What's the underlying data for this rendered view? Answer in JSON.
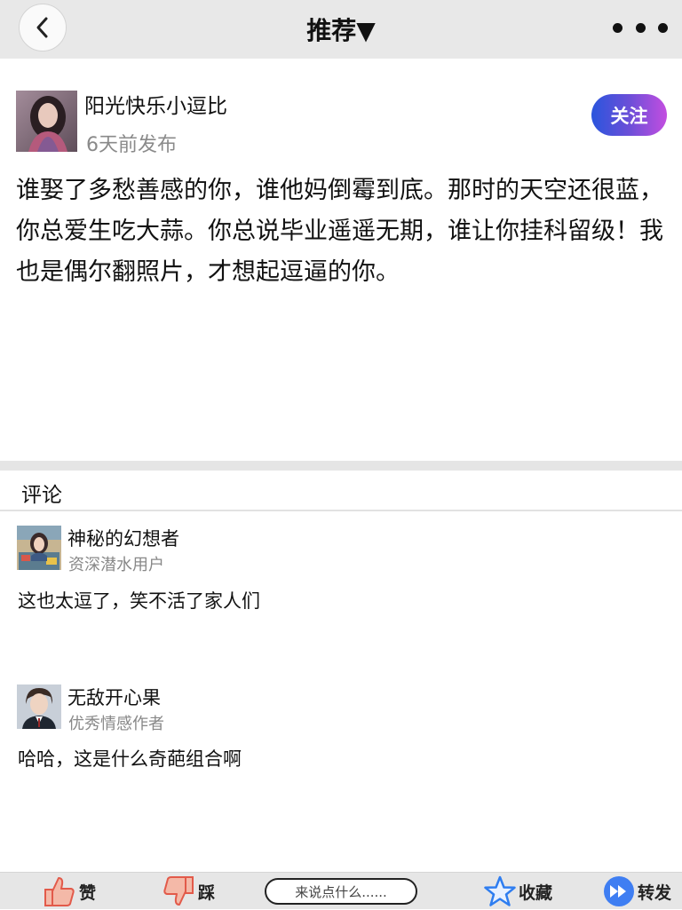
{
  "header": {
    "title": "推荐▼"
  },
  "post": {
    "author": "阳光快乐小逗比",
    "time": "6天前发布",
    "follow_label": "关注",
    "text": "谁娶了多愁善感的你，谁他妈倒霉到底。那时的天空还很蓝，你总爱生吃大蒜。你总说毕业遥遥无期，谁让你挂科留级！我也是偶尔翻照片，才想起逗逼的你。"
  },
  "comments_section": {
    "title": "评论",
    "items": [
      {
        "name": "神秘的幻想者",
        "role": "资深潜水用户",
        "text": "这也太逗了，笑不活了家人们"
      },
      {
        "name": "无敌开心果",
        "role": "优秀情感作者",
        "text": "哈哈，这是什么奇葩组合啊"
      }
    ]
  },
  "bottom_bar": {
    "like_label": "赞",
    "dislike_label": "踩",
    "comment_placeholder": "来说点什么......",
    "favorite_label": "收藏",
    "share_label": "转发"
  },
  "colors": {
    "follow_gradient": [
      "#2a55dd",
      "#c34ee0"
    ],
    "star_blue": "#2e7df0",
    "share_blue": "#3f7ef2",
    "thumb_fill": "#f4b9a8"
  },
  "icons": [
    "back-chevron-icon",
    "more-dots-icon",
    "thumbs-up-icon",
    "thumbs-down-icon",
    "star-icon",
    "forward-icon"
  ]
}
